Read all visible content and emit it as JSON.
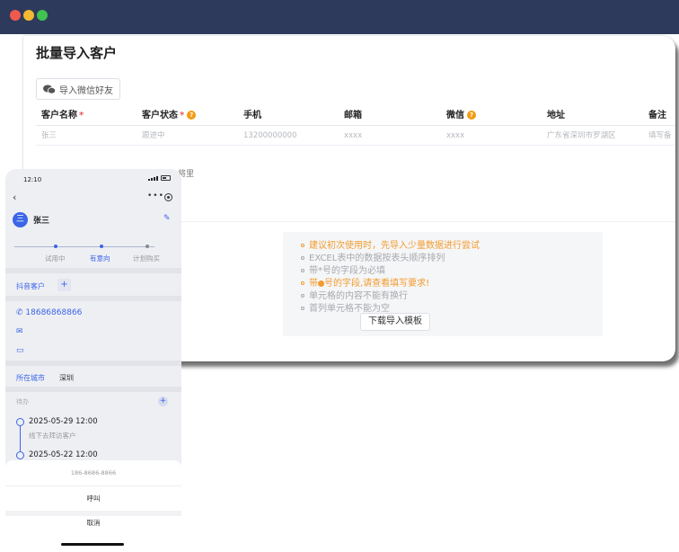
{
  "window": {
    "controls": [
      "close",
      "minimize",
      "maximize"
    ],
    "colors": {
      "titlebar": "#2e3a5c",
      "close": "#ef5a4f",
      "minimize": "#f4b833",
      "maximize": "#3fc24f"
    }
  },
  "card": {
    "title": "批量导入客户",
    "wechat_button": "导入微信好友",
    "table": {
      "headers": [
        {
          "label": "客户名称",
          "required": "*",
          "help": ""
        },
        {
          "label": "客户状态",
          "required": "*",
          "help": "?"
        },
        {
          "label": "手机",
          "required": "",
          "help": ""
        },
        {
          "label": "邮箱",
          "required": "",
          "help": ""
        },
        {
          "label": "微信",
          "required": "",
          "help": "?"
        },
        {
          "label": "地址",
          "required": "",
          "help": ""
        },
        {
          "label": "备注",
          "required": "",
          "help": ""
        }
      ],
      "row": [
        "张三",
        "跟进中",
        "13200000000",
        "xxxx",
        "xxxx",
        "广东省深圳市罗湖区",
        "填写备"
      ]
    },
    "partial_text": "将里",
    "tips": [
      "建议初次使用时，先导入少量数据进行尝试",
      "EXCEL表中的数据按表头顺序排列",
      "带*号的字段为必填",
      "号的字段,请查看填写要求!",
      "单元格的内容不能有换行",
      "首列单元格不能为空"
    ],
    "tip4_prefix": "带",
    "download_button": "下载导入模板",
    "accent": "#f29c30"
  },
  "phone": {
    "status_time": "12:10",
    "back_icon": "chevron-left-icon",
    "more_icon": "more-dots-icon",
    "avatar_char": "三",
    "name": "张三",
    "stages": [
      "试用中",
      "有意向",
      "计划购买"
    ],
    "active_stage": "有意向",
    "tag": "抖音客户",
    "add_tag": "+",
    "phone_number": "18686868866",
    "city_label": "所在城市",
    "city": "深圳",
    "todo_label": "待办",
    "todo_add": "+",
    "todos": [
      {
        "time": "2025-05-29 12:00",
        "desc": "线下去拜访客户"
      },
      {
        "time": "2025-05-22 12:00",
        "desc": ""
      }
    ],
    "sheet": {
      "number": "186-8686-8866",
      "call": "呼叫",
      "cancel": "取消"
    },
    "accent": "#3b64e6"
  }
}
